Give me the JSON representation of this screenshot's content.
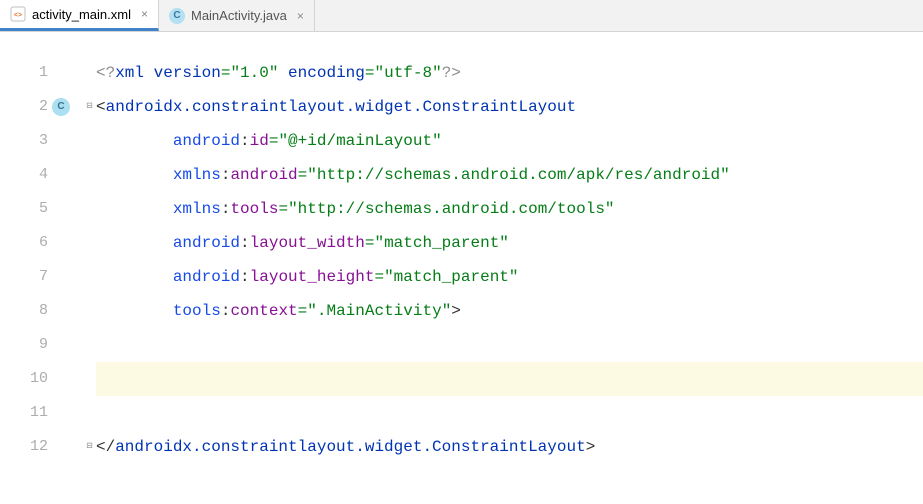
{
  "tabs": [
    {
      "label": "activity_main.xml",
      "icon": "xml",
      "active": true
    },
    {
      "label": "MainActivity.java",
      "icon": "java",
      "active": false
    }
  ],
  "gutter_badge_line": 2,
  "gutter_badge_text": "C",
  "highlight_line": 10,
  "fold_lines": {
    "open": 2,
    "close": 12
  },
  "lines": [
    {
      "n": 1,
      "tokens": [
        {
          "t": "<?",
          "c": "t-pi"
        },
        {
          "t": "xml version",
          "c": "t-tag"
        },
        {
          "t": "=",
          "c": "t-eq"
        },
        {
          "t": "\"1.0\"",
          "c": "t-str"
        },
        {
          "t": " encoding",
          "c": "t-tag"
        },
        {
          "t": "=",
          "c": "t-eq"
        },
        {
          "t": "\"utf-8\"",
          "c": "t-str"
        },
        {
          "t": "?>",
          "c": "t-pi"
        }
      ]
    },
    {
      "n": 2,
      "tokens": [
        {
          "t": "<",
          "c": "t-punc"
        },
        {
          "t": "androidx.constraintlayout.widget.ConstraintLayout",
          "c": "t-tag"
        }
      ]
    },
    {
      "n": 3,
      "indent": "        ",
      "tokens": [
        {
          "t": "android",
          "c": "t-ns"
        },
        {
          "t": ":",
          "c": "t-punc"
        },
        {
          "t": "id",
          "c": "t-attr"
        },
        {
          "t": "=",
          "c": "t-eq"
        },
        {
          "t": "\"@+id/mainLayout\"",
          "c": "t-str"
        }
      ]
    },
    {
      "n": 4,
      "indent": "        ",
      "tokens": [
        {
          "t": "xmlns",
          "c": "t-ns"
        },
        {
          "t": ":",
          "c": "t-punc"
        },
        {
          "t": "android",
          "c": "t-attr"
        },
        {
          "t": "=",
          "c": "t-eq"
        },
        {
          "t": "\"http://schemas.android.com/apk/res/android\"",
          "c": "t-str"
        }
      ]
    },
    {
      "n": 5,
      "indent": "        ",
      "tokens": [
        {
          "t": "xmlns",
          "c": "t-ns"
        },
        {
          "t": ":",
          "c": "t-punc"
        },
        {
          "t": "tools",
          "c": "t-attr"
        },
        {
          "t": "=",
          "c": "t-eq"
        },
        {
          "t": "\"http://schemas.android.com/tools\"",
          "c": "t-str"
        }
      ]
    },
    {
      "n": 6,
      "indent": "        ",
      "tokens": [
        {
          "t": "android",
          "c": "t-ns"
        },
        {
          "t": ":",
          "c": "t-punc"
        },
        {
          "t": "layout_width",
          "c": "t-attr"
        },
        {
          "t": "=",
          "c": "t-eq"
        },
        {
          "t": "\"match_parent\"",
          "c": "t-str"
        }
      ]
    },
    {
      "n": 7,
      "indent": "        ",
      "tokens": [
        {
          "t": "android",
          "c": "t-ns"
        },
        {
          "t": ":",
          "c": "t-punc"
        },
        {
          "t": "layout_height",
          "c": "t-attr"
        },
        {
          "t": "=",
          "c": "t-eq"
        },
        {
          "t": "\"match_parent\"",
          "c": "t-str"
        }
      ]
    },
    {
      "n": 8,
      "indent": "        ",
      "tokens": [
        {
          "t": "tools",
          "c": "t-ns"
        },
        {
          "t": ":",
          "c": "t-punc"
        },
        {
          "t": "context",
          "c": "t-attr"
        },
        {
          "t": "=",
          "c": "t-eq"
        },
        {
          "t": "\".MainActivity\"",
          "c": "t-str"
        },
        {
          "t": ">",
          "c": "t-punc"
        }
      ]
    },
    {
      "n": 9,
      "tokens": []
    },
    {
      "n": 10,
      "tokens": []
    },
    {
      "n": 11,
      "tokens": []
    },
    {
      "n": 12,
      "tokens": [
        {
          "t": "</",
          "c": "t-punc"
        },
        {
          "t": "androidx.constraintlayout.widget.ConstraintLayout",
          "c": "t-tag"
        },
        {
          "t": ">",
          "c": "t-punc"
        }
      ]
    }
  ]
}
